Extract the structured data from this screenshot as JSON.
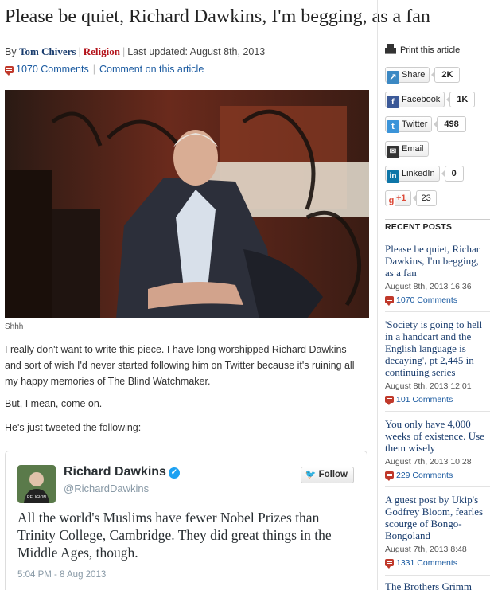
{
  "article": {
    "headline": "Please be quiet, Richard Dawkins, I'm begging, as a fan",
    "by_prefix": "By",
    "author": "Tom Chivers",
    "category": "Religion",
    "updated": "Last updated: August 8th, 2013",
    "comments_count": "1070 Comments",
    "comment_link": "Comment on this article",
    "photo_caption": "Shhh",
    "paragraphs": [
      "I really don't want to write this piece. I have long worshipped Richard Dawkins and sort of wish I'd never started following him on Twitter because it's ruining all my happy memories of The Blind Watchmaker.",
      "But, I mean, come on.",
      "He's just tweeted the following:"
    ]
  },
  "tweet": {
    "name": "Richard Dawkins",
    "handle": "@RichardDawkins",
    "follow_label": "Follow",
    "text": "All the world's Muslims have fewer Nobel Prizes than Trinity College, Cambridge. They did great things in the Middle Ages, though.",
    "time": "5:04 PM - 8 Aug 2013",
    "avatar_text": "RELIGION"
  },
  "sidebar": {
    "print_label": "Print this article",
    "share": [
      {
        "label": "Share",
        "count": "2K",
        "icon": "share-icon",
        "color": "#3b88c3"
      },
      {
        "label": "Facebook",
        "count": "1K",
        "icon": "facebook-icon",
        "color": "#3b5998"
      },
      {
        "label": "Twitter",
        "count": "498",
        "icon": "twitter-icon",
        "color": "#3b94d9"
      },
      {
        "label": "Email",
        "count": "",
        "icon": "email-icon",
        "color": "#333333"
      },
      {
        "label": "LinkedIn",
        "count": "0",
        "icon": "linkedin-icon",
        "color": "#0e76a8"
      },
      {
        "label": "+1",
        "count": "23",
        "icon": "google-plus-icon",
        "color": "#dd4b39"
      }
    ],
    "recent_title": "RECENT POSTS",
    "recent_posts": [
      {
        "title_lines": [
          "Please be quiet, Richar",
          "Dawkins, I'm begging,",
          "as a fan"
        ],
        "date": "August 8th, 2013 16:36",
        "comments": "1070 Comments"
      },
      {
        "title_lines": [
          "'Society is going to hell",
          "in a handcart and the",
          "English language is",
          "decaying', pt 2,445 in",
          "continuing series"
        ],
        "date": "August 8th, 2013 12:01",
        "comments": "101 Comments"
      },
      {
        "title_lines": [
          "You only have 4,000",
          "weeks of existence. Use",
          "them wisely"
        ],
        "date": "August 7th, 2013 10:28",
        "comments": "229 Comments"
      },
      {
        "title_lines": [
          "A guest post by Ukip's",
          "Godfrey Bloom, fearles",
          "scourge of Bongo-",
          "Bongoland"
        ],
        "date": "August 7th, 2013 8:48",
        "comments": "1331 Comments"
      },
      {
        "title_lines": [
          "The Brothers Grimm"
        ],
        "date": "",
        "comments": ""
      }
    ]
  },
  "colors": {
    "link_blue": "#1a5aa0",
    "headline_navy": "#1a3d6e",
    "category_red": "#b3121a",
    "twitter_blue": "#1da1f2"
  }
}
